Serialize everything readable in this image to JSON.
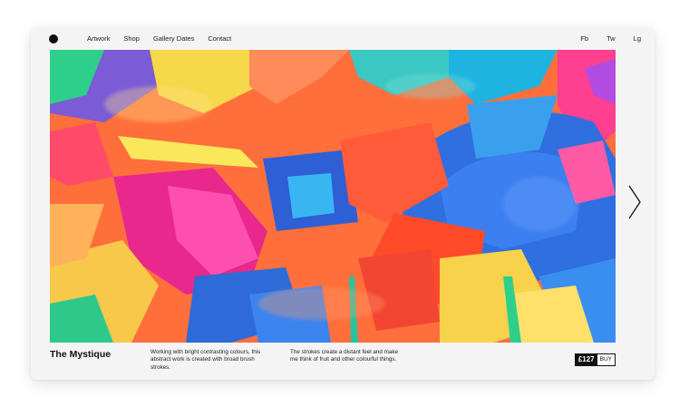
{
  "nav": {
    "links": [
      "Artwork",
      "Shop",
      "Gallery Dates",
      "Contact"
    ],
    "social": [
      "Fb",
      "Tw",
      "Lg"
    ]
  },
  "product": {
    "title": "The Mystique",
    "description_1": "Working with bright contrasting colours, this abstract work is created with broad brush strokes.",
    "description_2": "The strokes create a distant feel and make me think of fruit and other colourful things.",
    "price": "£127",
    "buy_label": "BUY"
  },
  "icons": {
    "logo": "logo-dot-icon",
    "next": "chevron-right-icon"
  },
  "colors": {
    "background": "#ffffff",
    "card": "#f4f4f4",
    "text": "#111111",
    "price_bg": "#111111"
  }
}
